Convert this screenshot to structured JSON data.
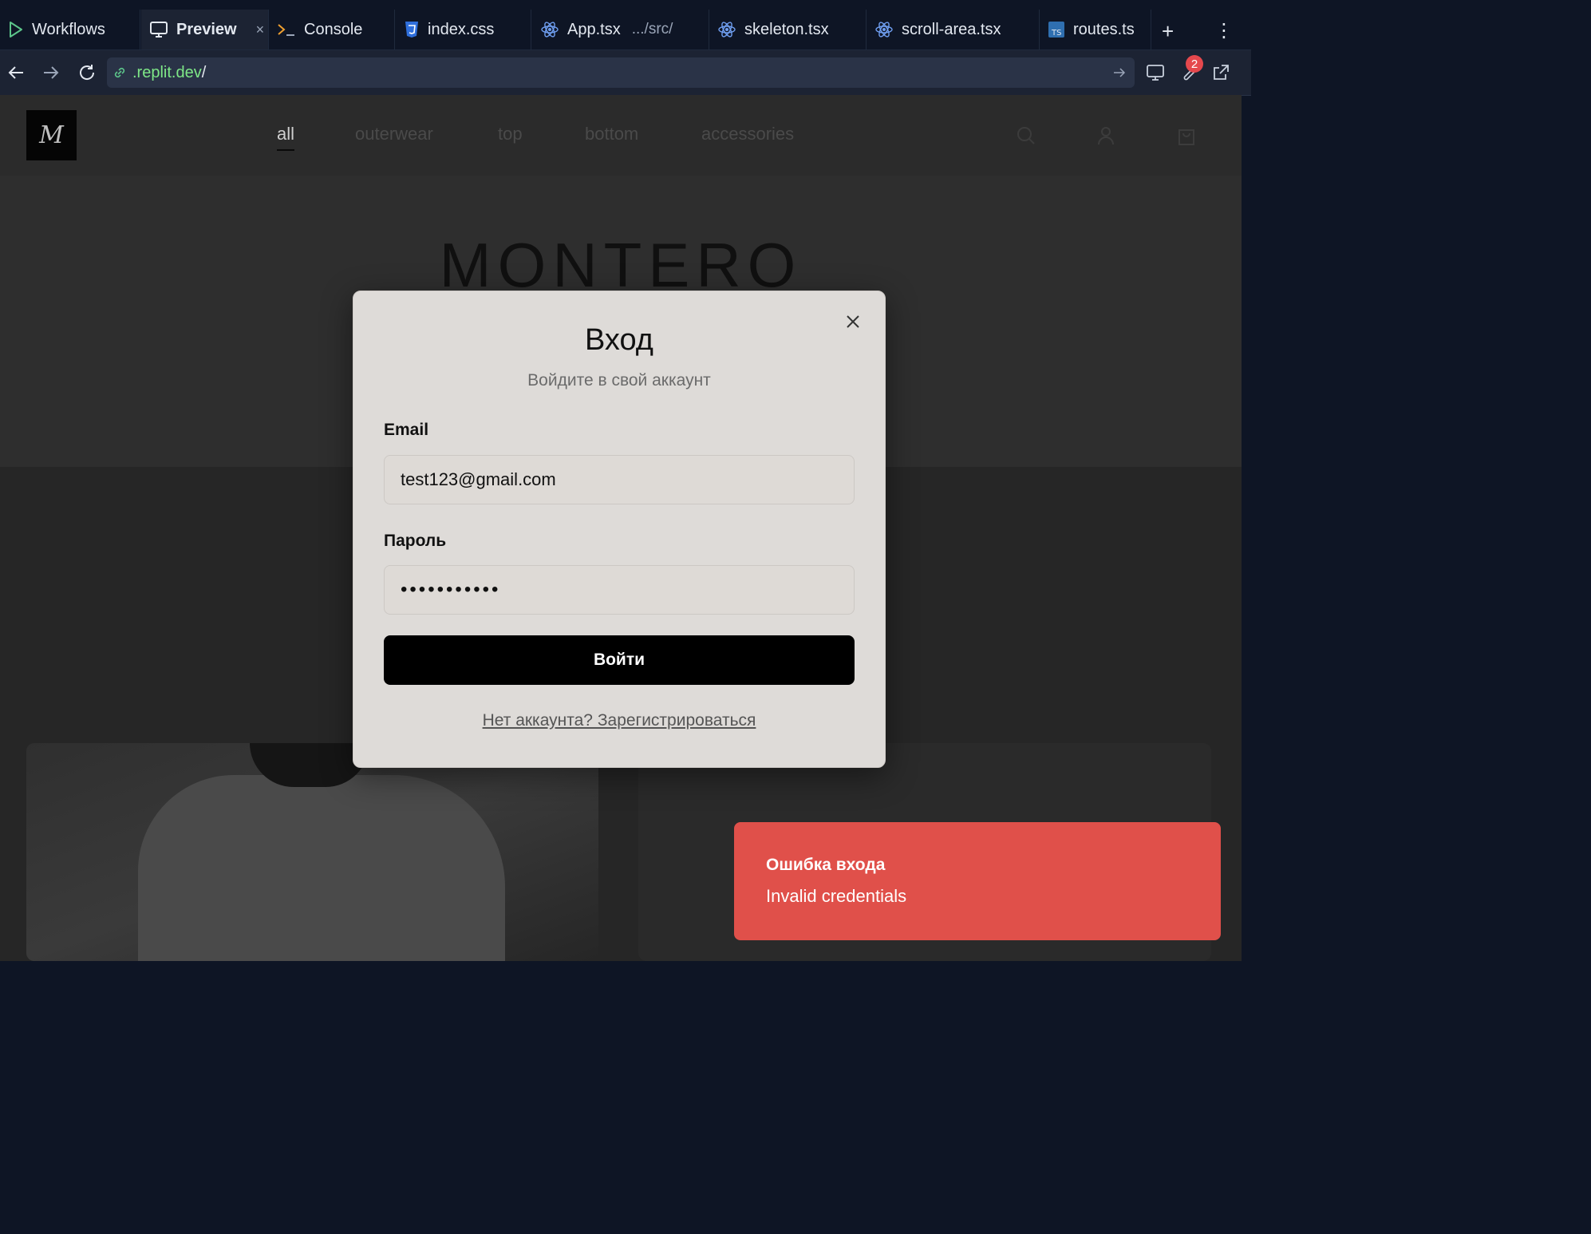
{
  "tabs": [
    {
      "label": "Workflows",
      "icon": "play-icon"
    },
    {
      "label": "Preview",
      "icon": "monitor-icon",
      "close": "×"
    },
    {
      "label": "Console",
      "icon": "terminal-icon"
    },
    {
      "label": "index.css",
      "icon": "css-icon"
    },
    {
      "label": "App.tsx",
      "sub": ".../src/",
      "icon": "react-icon"
    },
    {
      "label": "skeleton.tsx",
      "icon": "react-icon"
    },
    {
      "label": "scroll-area.tsx",
      "icon": "react-icon"
    },
    {
      "label": "routes.ts",
      "icon": "ts-icon"
    }
  ],
  "tab_add": "+",
  "tab_more": "⋮",
  "url": {
    "host": ".replit.dev",
    "path": "/"
  },
  "devtools_badge": "2",
  "site": {
    "logo": "M",
    "categories": [
      "all",
      "outerwear",
      "top",
      "bottom",
      "accessories"
    ],
    "brand": "MONTERO"
  },
  "login": {
    "title": "Вход",
    "subtitle": "Войдите в свой аккаунт",
    "email_label": "Email",
    "email_value": "test123@gmail.com",
    "password_label": "Пароль",
    "password_value": "•••••••••••",
    "submit": "Войти",
    "register_link": "Нет аккаунта? Зарегистрироваться"
  },
  "toast": {
    "title": "Ошибка входа",
    "message": "Invalid credentials",
    "color": "#e0504a"
  }
}
